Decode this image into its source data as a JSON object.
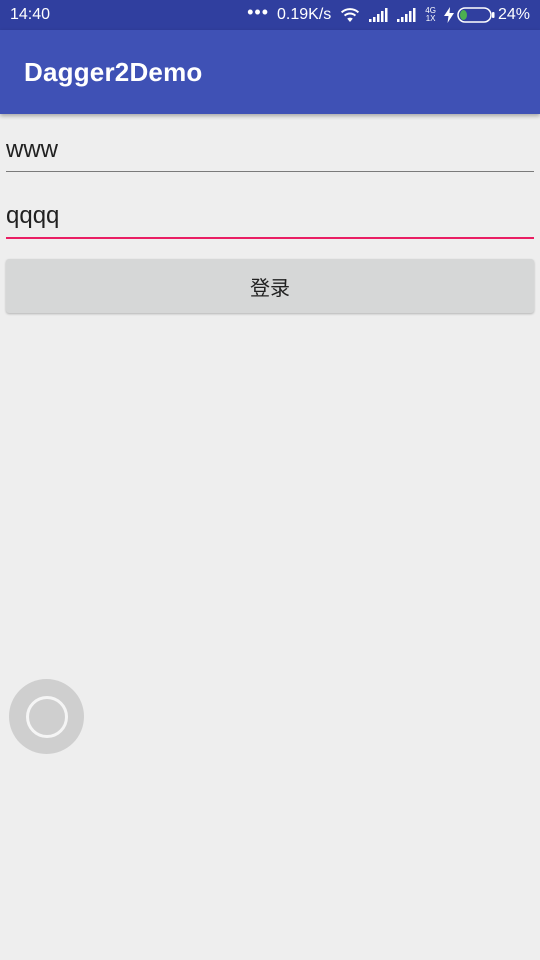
{
  "status_bar": {
    "time": "14:40",
    "dots": "•••",
    "network_speed": "0.19K/s",
    "net_type_top": "4G",
    "net_type_bottom": "1X",
    "battery_level": 0.24,
    "battery_percent": "24%",
    "icons": [
      "wifi-icon",
      "signal-icon",
      "signal-icon",
      "charging-icon",
      "battery-icon"
    ],
    "colors": {
      "background": "#303f9f",
      "battery_fill": "#4caf50"
    }
  },
  "app_bar": {
    "title": "Dagger2Demo",
    "color": "#3f51b5"
  },
  "form": {
    "username_value": "www",
    "password_value": "qqqq",
    "focus_color": "#e91e63",
    "login_label": "登录"
  },
  "floating_ball": {
    "icon": "assistive-touch-icon"
  }
}
